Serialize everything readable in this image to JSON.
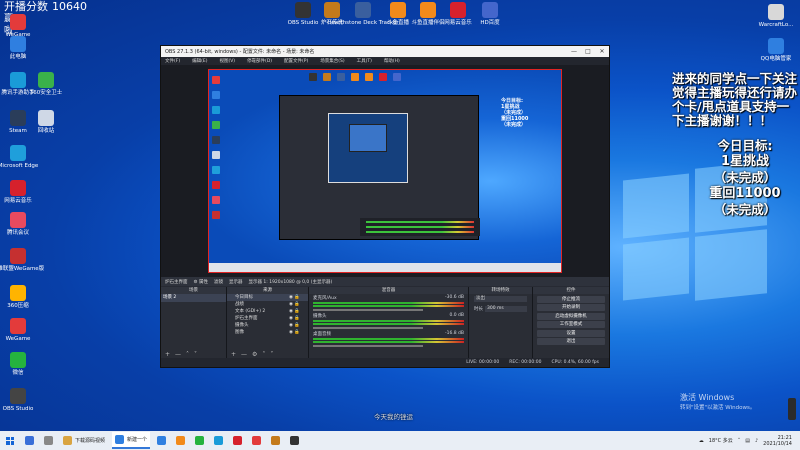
{
  "stream_overlay": {
    "score_label": "开播分数",
    "score_value": "10640",
    "status": "赢啦"
  },
  "desktop_icons_left": [
    {
      "label": "WeGame",
      "color": "#e33b3b"
    },
    {
      "label": "此电脑",
      "color": "#2f7fe0"
    },
    {
      "label": "腾讯手游助手",
      "color": "#1a9bd8"
    },
    {
      "label": "360安全卫士",
      "color": "#3ab14a"
    },
    {
      "label": "Steam",
      "color": "#2a3d5a"
    },
    {
      "label": "回收站",
      "color": "#cfd8e6"
    },
    {
      "label": "Microsoft Edge",
      "color": "#1f9fdb"
    },
    {
      "label": "网易云音乐",
      "color": "#d6212c"
    },
    {
      "label": "腾讯会议",
      "color": "#e84a5f"
    },
    {
      "label": "英雄联盟WeGame版",
      "color": "#c53030"
    },
    {
      "label": "360压缩",
      "color": "#ffb400"
    },
    {
      "label": "WeGame",
      "color": "#e33b3b"
    },
    {
      "label": "微信",
      "color": "#25b33e"
    },
    {
      "label": "OBS Studio",
      "color": "#444"
    }
  ],
  "desktop_icons_top": [
    {
      "label": "OBS Studio",
      "color": "#333"
    },
    {
      "label": "炉石传说",
      "color": "#c47a1b"
    },
    {
      "label": "Hearthstone Deck Tracker",
      "color": "#3a5f9e"
    },
    {
      "label": "斗鱼直播",
      "color": "#f28a1a"
    },
    {
      "label": "斗鱼直播伴侣",
      "color": "#f28a1a"
    },
    {
      "label": "网易云音乐",
      "color": "#d6212c"
    },
    {
      "label": "HD百度",
      "color": "#4466cc"
    }
  ],
  "desktop_icons_right": [
    {
      "label": "WarcraftLo...",
      "color": "#d8d8d8"
    },
    {
      "label": "QQ电脑管家",
      "color": "#2f7fe0"
    }
  ],
  "announcement": "进来的同学点一下关注觉得主播玩得还行请办个卡/甩点道具支持一下主播谢谢！！！",
  "goals": {
    "title": "今日目标:",
    "goal1": "1星挑战",
    "goal1_status": "（未完成）",
    "goal2": "重回11000",
    "goal2_status": "（未完成）"
  },
  "obs": {
    "title": "OBS 27.1.3 (64-bit, windows) - 配置文件: 未命名 - 场景: 未命名",
    "menu": [
      "文件(F)",
      "编辑(E)",
      "视图(V)",
      "停靠部件(D)",
      "配置文件(P)",
      "场景集合(S)",
      "工具(T)",
      "帮助(H)"
    ],
    "scene_bar": [
      "炉石主界面",
      "属性",
      "滤镜",
      "显示器",
      "显示器 1: 1920x1080 @ 0,0 (主显示器)"
    ],
    "dock_scenes_header": "场景",
    "dock_sources_header": "来源",
    "dock_mixer_header": "混音器",
    "dock_transitions_header": "转场特效",
    "dock_controls_header": "控件",
    "scenes": [
      "场景 2"
    ],
    "sources": [
      "今日目标",
      "战绩",
      "文本 (GDI+) 2",
      "炉石主界面",
      "摄像头",
      "图像"
    ],
    "mixer": [
      {
        "name": "麦克风/Aux",
        "db": "-30.6 dB"
      },
      {
        "name": "摄像头",
        "db": "0.0 dB"
      },
      {
        "name": "桌面音频",
        "db": "-16.8 dB"
      }
    ],
    "transition": "淡出",
    "transition_duration_label": "时长",
    "transition_duration": "300 ms",
    "controls": [
      "停止推流",
      "开始录制",
      "启动虚拟摄像机",
      "工作室模式",
      "设置",
      "退出"
    ],
    "status": {
      "live": "LIVE: 00:00:00",
      "rec": "REC: 00:00:00",
      "cpu": "CPU: 0.4%, 60.00 fps"
    }
  },
  "subtitle_bar": "今天我的锉运",
  "windows_activation": {
    "title": "激活 Windows",
    "subtitle": "转到\"设置\"以激活 Windows。"
  },
  "taskbar": {
    "apps": [
      {
        "label": "",
        "color": "#3a6fd8"
      },
      {
        "label": "",
        "color": "#888"
      },
      {
        "label": "下载源码视频",
        "color": "#d9a441"
      },
      {
        "label": "新建一个",
        "color": "#2f7fe0"
      },
      {
        "label": "",
        "color": "#2f7fe0"
      },
      {
        "label": "",
        "color": "#f28a1a"
      },
      {
        "label": "",
        "color": "#25b33e"
      },
      {
        "label": "",
        "color": "#1a9bd8"
      },
      {
        "label": "",
        "color": "#d6212c"
      },
      {
        "label": "",
        "color": "#e33b3b"
      },
      {
        "label": "",
        "color": "#c47a1b"
      },
      {
        "label": "",
        "color": "#333"
      }
    ],
    "weather": "18°C 多云",
    "time": "21:21",
    "date": "2021/10/14"
  }
}
